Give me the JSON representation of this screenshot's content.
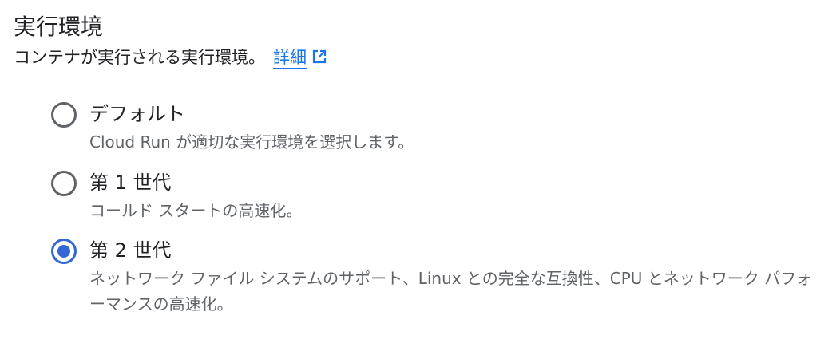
{
  "section": {
    "title": "実行環境",
    "description": "コンテナが実行される実行環境。",
    "learn_more_label": "詳細",
    "external_icon": "open-in-new-icon"
  },
  "options": [
    {
      "label": "デフォルト",
      "help": "Cloud Run が適切な実行環境を選択します。",
      "checked": false
    },
    {
      "label": "第 1 世代",
      "help": "コールド スタートの高速化。",
      "checked": false
    },
    {
      "label": "第 2 世代",
      "help": "ネットワーク ファイル システムのサポート、Linux との完全な互換性、CPU とネットワーク パフォーマンスの高速化。",
      "checked": true
    }
  ],
  "colors": {
    "accent": "#3367d6",
    "link": "#1a73e8",
    "text": "#202124",
    "secondary_text": "#5f6368"
  }
}
